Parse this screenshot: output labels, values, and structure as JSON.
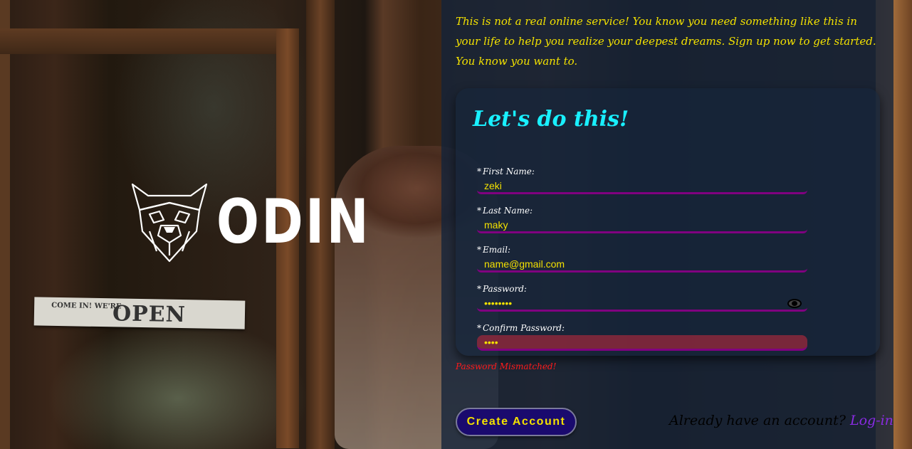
{
  "brand": {
    "name": "ODIN",
    "logo_icon": "viking-dog-icon"
  },
  "intro": {
    "line1": "This is not a real online service! You know you need something like this in your life to help you realize your deepest dreams. Sign up now to get started.",
    "line2": "You know you want to."
  },
  "background_sign": {
    "small": "COME IN! WE'RE",
    "big": "OPEN"
  },
  "form": {
    "title": "Let's do this!",
    "required_marker": "*",
    "fields": [
      {
        "label": "First Name:",
        "value": "zeki",
        "type": "text"
      },
      {
        "label": "Last Name:",
        "value": "maky",
        "type": "text"
      },
      {
        "label": "Email:",
        "value": "name@gmail.com",
        "type": "email"
      },
      {
        "label": "Password:",
        "value": "••••••••",
        "type": "password",
        "toggle_icon": "eye-icon"
      },
      {
        "label": "Confirm Password:",
        "value": "••••",
        "type": "password",
        "invalid": true
      }
    ],
    "error": "Password Mismatched!",
    "submit_label": "Create Account"
  },
  "login": {
    "prompt": "Already have an account? ",
    "link_label": "Log-in"
  },
  "colors": {
    "accent_yellow": "#f3e100",
    "title_cyan": "#19f0ff",
    "underline_purple": "#800080",
    "error_red": "#ff1a1a",
    "button_bg": "#1a0a6e",
    "link_violet": "#8a2be2"
  }
}
